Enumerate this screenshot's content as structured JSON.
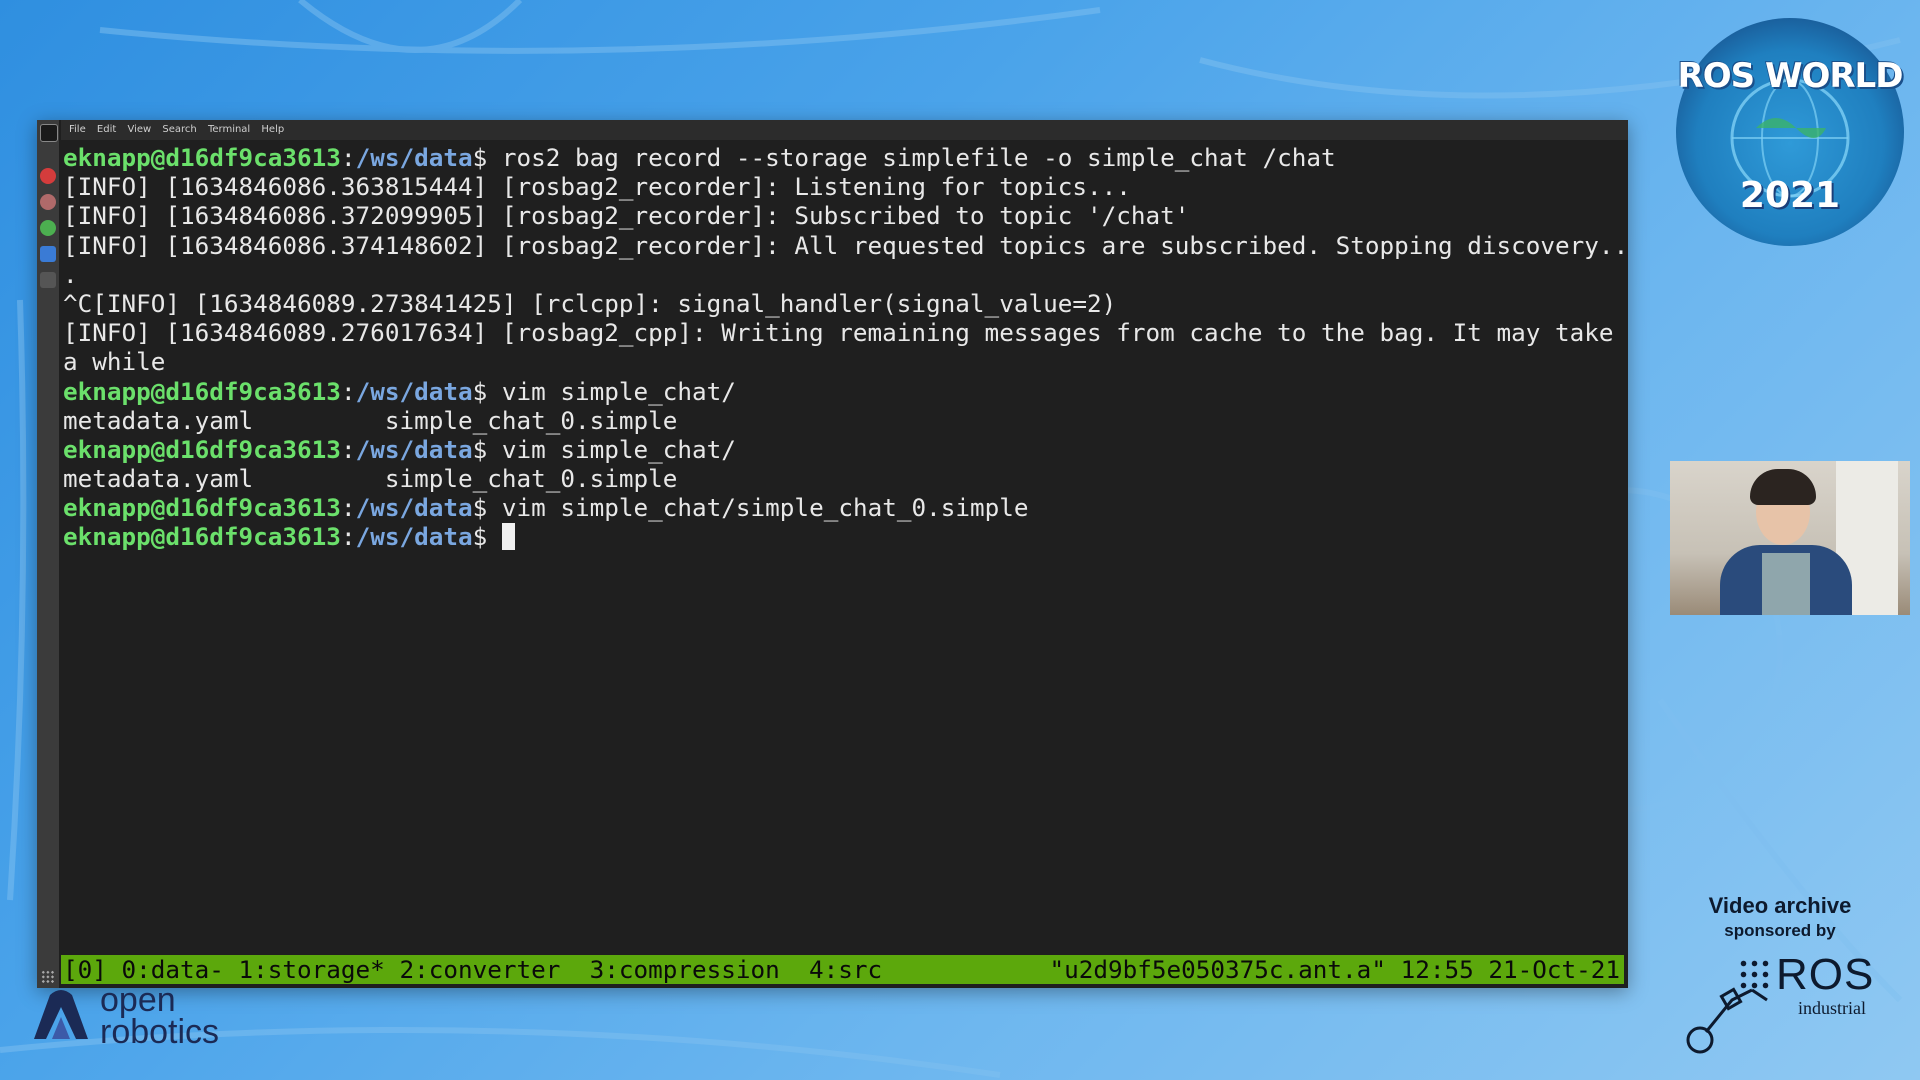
{
  "colors": {
    "background": "#4aa3ea",
    "terminal_bg": "#1f1f1f",
    "prompt_user": "#6be06b",
    "prompt_path": "#7aa7e0",
    "status_bar": "#5ca80c"
  },
  "terminal": {
    "menu": [
      "File",
      "Edit",
      "View",
      "Search",
      "Terminal",
      "Help"
    ],
    "prompt": {
      "user_host": "eknapp@d16df9ca3613",
      "sep": ":",
      "path": "/ws/data",
      "symbol": "$"
    },
    "lines": {
      "l1_cmd": " ros2 bag record --storage simplefile -o simple_chat /chat",
      "l2": "[INFO] [1634846086.363815444] [rosbag2_recorder]: Listening for topics...",
      "l3": "[INFO] [1634846086.372099905] [rosbag2_recorder]: Subscribed to topic '/chat'",
      "l4": "[INFO] [1634846086.374148602] [rosbag2_recorder]: All requested topics are subscribed. Stopping discovery..",
      "l5": ".",
      "l6": "^C[INFO] [1634846089.273841425] [rclcpp]: signal_handler(signal_value=2)",
      "l7": "[INFO] [1634846089.276017634] [rosbag2_cpp]: Writing remaining messages from cache to the bag. It may take",
      "l8": "a while",
      "l9_cmd": " vim simple_chat/",
      "l10": "metadata.yaml         simple_chat_0.simple",
      "l11_cmd": " vim simple_chat/",
      "l12": "metadata.yaml         simple_chat_0.simple",
      "l13_cmd": " vim simple_chat/simple_chat_0.simple",
      "l14_cmd": " "
    },
    "status_left": "[0] 0:data- 1:storage* 2:converter  3:compression  4:src",
    "status_right": "\"u2d9bf5e050375c.ant.a\" 12:55 21-Oct-21"
  },
  "logo": {
    "title": "ROS WORLD",
    "year": "2021"
  },
  "sponsor": {
    "line1": "Video archive",
    "line2": "sponsored by",
    "ros": "ROS",
    "industrial": "industrial"
  },
  "open_robotics": {
    "line1": "open",
    "line2": "robotics"
  }
}
